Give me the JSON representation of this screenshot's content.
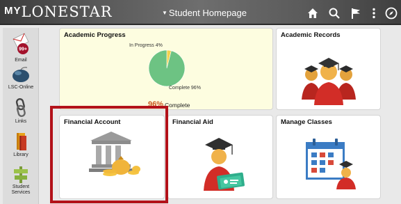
{
  "header": {
    "logo_my": "MY",
    "logo_name": "LONESTAR",
    "title": "Student Homepage",
    "icons": [
      "home-icon",
      "search-icon",
      "flag-icon",
      "more-icon",
      "navbar-compass-icon"
    ]
  },
  "sidebar": {
    "items": [
      {
        "label": "Email",
        "badge": "99+",
        "icon": "email-icon"
      },
      {
        "label": "LSC-Online",
        "icon": "mouse-icon"
      },
      {
        "label": "Links",
        "icon": "chain-link-icon"
      },
      {
        "label": "Library",
        "icon": "books-icon"
      },
      {
        "label": "Student Services",
        "icon": "signpost-icon"
      }
    ]
  },
  "tiles": {
    "academic_progress": {
      "title": "Academic Progress",
      "in_progress_label": "In Progress 4%",
      "complete_label": "Complete 96%",
      "big_value": "96%",
      "big_value_label": "Complete"
    },
    "academic_records": {
      "title": "Academic Records"
    },
    "financial_account": {
      "title": "Financial Account"
    },
    "financial_aid": {
      "title": "Financial Aid"
    },
    "manage_classes": {
      "title": "Manage Classes"
    }
  },
  "chart_data": {
    "type": "pie",
    "categories": [
      "In Progress",
      "Complete"
    ],
    "values": [
      4,
      96
    ],
    "colors": [
      "#f3d24e",
      "#6dc383"
    ]
  },
  "colors": {
    "highlight_border": "#b3121a",
    "progress_tile_bg": "#fdfde0",
    "percent_text": "#c9561e"
  }
}
